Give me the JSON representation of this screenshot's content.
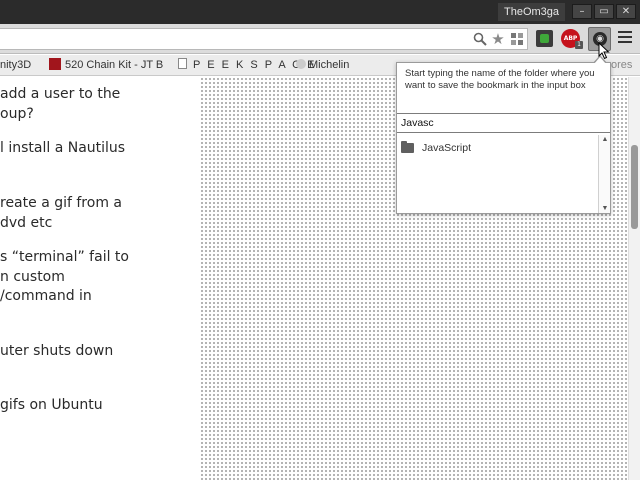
{
  "titlebar": {
    "profile_name": "TheOm3ga",
    "buttons": [
      "–",
      "▭",
      "✕"
    ]
  },
  "toolbar": {
    "icons": [
      "zoom-icon",
      "bookmark-star-icon",
      "extension-icon",
      "adblock-plus-icon",
      "bookmark-folder-extension-icon",
      "chrome-menu-icon"
    ],
    "abp_label": "ABP",
    "abp_badge": "1"
  },
  "bookmarks_bar": {
    "items": [
      {
        "label": "nity3D"
      },
      {
        "label": "520 Chain Kit - JT B"
      },
      {
        "label": "P E E K S P A C E"
      },
      {
        "label": "Michelin"
      },
      {
        "label": "ores"
      }
    ]
  },
  "page": {
    "questions": [
      {
        "lines": [
          "add a user to the",
          "oup?"
        ]
      },
      {
        "lines": [
          "l install a Nautilus"
        ]
      },
      {
        "lines": [
          "reate a gif from a",
          "dvd etc"
        ]
      },
      {
        "lines": [
          "s “terminal” fail to",
          "n custom",
          "/command in"
        ]
      },
      {
        "lines": [
          "uter shuts down"
        ]
      },
      {
        "lines": [
          "gifs on Ubuntu"
        ]
      }
    ]
  },
  "popup": {
    "instructions": "Start typing the name of the folder where you want to save the bookmark in the input box",
    "input_value": "Javasc",
    "folders": [
      {
        "label": "JavaScript"
      }
    ]
  },
  "colors": {
    "titlebar": "#2b2b2b",
    "abp_red": "#c5121c",
    "extension_green": "#3fa83a"
  }
}
